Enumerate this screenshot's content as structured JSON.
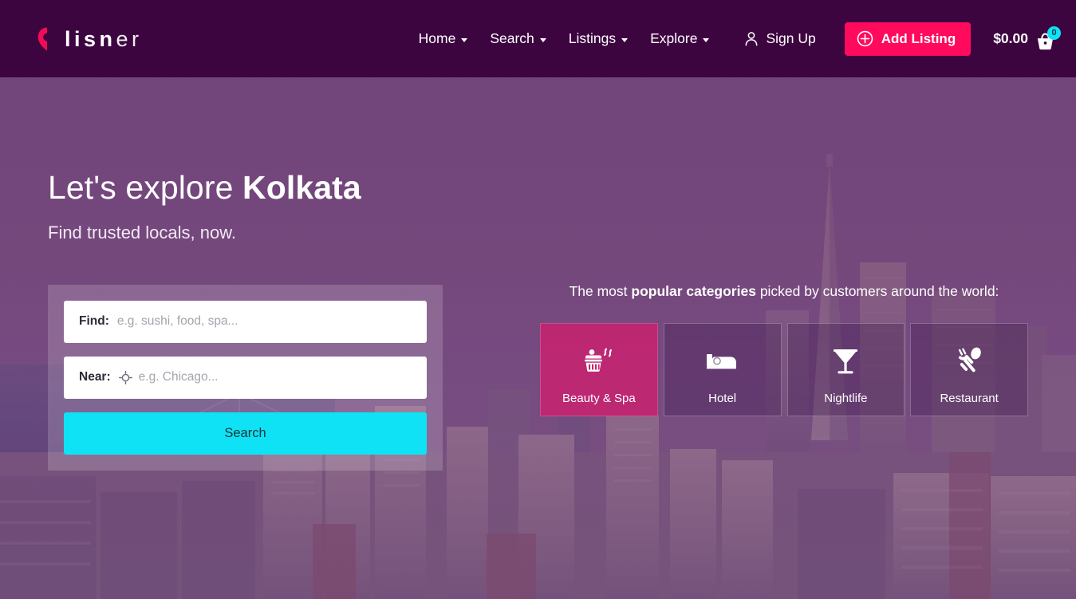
{
  "header": {
    "logo": {
      "icon": "location-pin-icon",
      "strong": "lisn",
      "light": "er"
    },
    "nav": [
      {
        "label": "Home",
        "has_dropdown": true
      },
      {
        "label": "Search",
        "has_dropdown": true
      },
      {
        "label": "Listings",
        "has_dropdown": true
      },
      {
        "label": "Explore",
        "has_dropdown": true
      }
    ],
    "signup": {
      "label": "Sign Up",
      "icon": "user-icon"
    },
    "add_listing": {
      "label": "Add Listing",
      "icon": "circle-plus-icon",
      "color": "#ff0a5c"
    },
    "cart": {
      "amount": "$0.00",
      "count": "0",
      "icon": "shopping-basket-icon",
      "badge_color": "#0fe2f5"
    }
  },
  "hero": {
    "title_prefix": "Let's explore ",
    "city": "Kolkata",
    "subtitle": "Find trusted locals, now.",
    "search": {
      "find_label": "Find:",
      "find_value": "",
      "find_placeholder": "e.g. sushi, food, spa...",
      "near_label": "Near:",
      "near_value": "",
      "near_placeholder": "e.g. Chicago...",
      "near_icon": "crosshair-locate-icon",
      "button_label": "Search",
      "button_color": "#0fe2f5"
    },
    "categories": {
      "heading_prefix": "The most ",
      "heading_bold": "popular categories",
      "heading_suffix": " picked by customers around the world:",
      "tiles": [
        {
          "label": "Beauty & Spa",
          "icon": "hot-tub-icon",
          "active": true
        },
        {
          "label": "Hotel",
          "icon": "bed-icon",
          "active": false
        },
        {
          "label": "Nightlife",
          "icon": "cocktail-glass-icon",
          "active": false
        },
        {
          "label": "Restaurant",
          "icon": "fork-spoon-icon",
          "active": false
        }
      ]
    }
  }
}
